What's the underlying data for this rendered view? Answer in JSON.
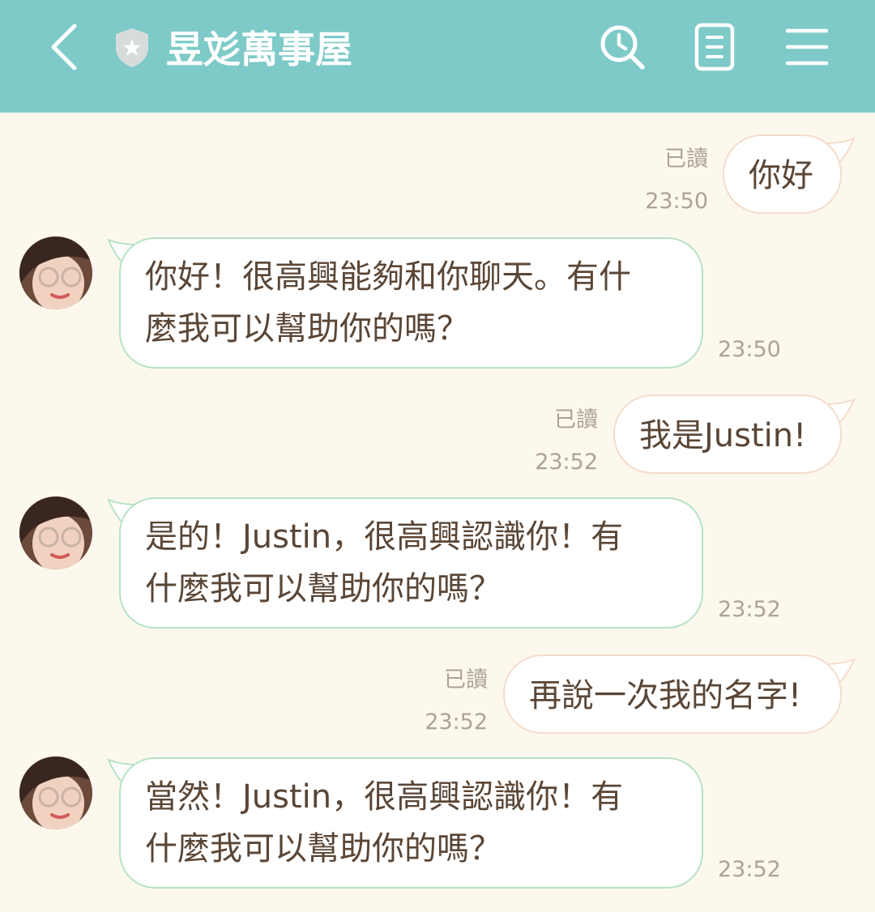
{
  "header": {
    "title": "昱彣萬事屋",
    "icons": {
      "back": "chevron-left-icon",
      "badge": "shield-star-icon",
      "search": "clock-search-icon",
      "notes": "notes-icon",
      "menu": "hamburger-menu-icon"
    }
  },
  "colors": {
    "header_bg": "#7ECAC8",
    "chat_bg": "#FDF8EE",
    "outgoing_border": "#F4DCCB",
    "incoming_border": "#B5E3C4",
    "text": "#5A4636",
    "meta": "#ABA29A"
  },
  "messages": [
    {
      "direction": "out",
      "lines": [
        "你好"
      ],
      "read": "已讀",
      "time": "23:50"
    },
    {
      "direction": "in",
      "lines": [
        "你好！很高興能夠和你聊天。有什",
        "麼我可以幫助你的嗎？"
      ],
      "time": "23:50"
    },
    {
      "direction": "out",
      "lines": [
        "我是Justin!"
      ],
      "read": "已讀",
      "time": "23:52"
    },
    {
      "direction": "in",
      "lines": [
        "是的！Justin，很高興認識你！有",
        "什麼我可以幫助你的嗎？"
      ],
      "time": "23:52"
    },
    {
      "direction": "out",
      "lines": [
        "再說一次我的名字!"
      ],
      "read": "已讀",
      "time": "23:52"
    },
    {
      "direction": "in",
      "lines": [
        "當然！Justin，很高興認識你！有",
        "什麼我可以幫助你的嗎？"
      ],
      "time": "23:52"
    }
  ]
}
